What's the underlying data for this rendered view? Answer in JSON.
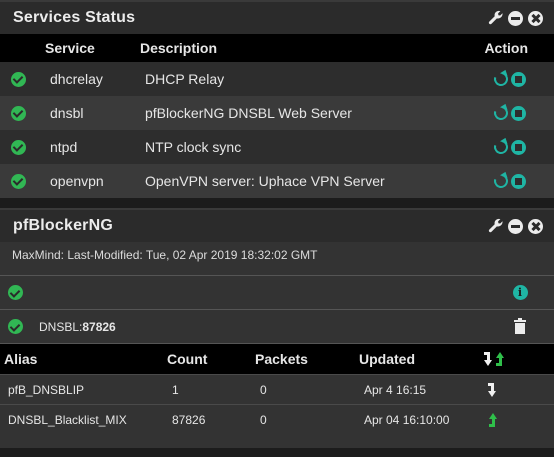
{
  "services": {
    "title": "Services Status",
    "columns": {
      "service": "Service",
      "description": "Description",
      "action": "Action"
    },
    "rows": [
      {
        "name": "dhcrelay",
        "description": "DHCP Relay"
      },
      {
        "name": "dnsbl",
        "description": "pfBlockerNG DNSBL Web Server"
      },
      {
        "name": "ntpd",
        "description": "NTP clock sync"
      },
      {
        "name": "openvpn",
        "description": "OpenVPN server: Uphace VPN Server"
      }
    ]
  },
  "pfblocker": {
    "title": "pfBlockerNG",
    "maxmind": "MaxMind: Last-Modified: Tue, 02 Apr 2019 18:32:02 GMT",
    "dnsbl_label": "DNSBL:",
    "dnsbl_count": "87826",
    "columns": {
      "alias": "Alias",
      "count": "Count",
      "packets": "Packets",
      "updated": "Updated"
    },
    "rows": [
      {
        "alias": "pfB_DNSBLIP",
        "count": "1",
        "packets": "0",
        "updated": "Apr 4 16:15",
        "icon": "arrow-down-icon"
      },
      {
        "alias": "DNSBL_Blacklist_MIX",
        "count": "87826",
        "packets": "0",
        "updated": "Apr 04 16:10:00",
        "icon": "arrow-up-icon"
      }
    ]
  },
  "colors": {
    "status_ok": "#31b754",
    "action": "#1fb5a4",
    "arrow_up": "#2fbf4a"
  }
}
